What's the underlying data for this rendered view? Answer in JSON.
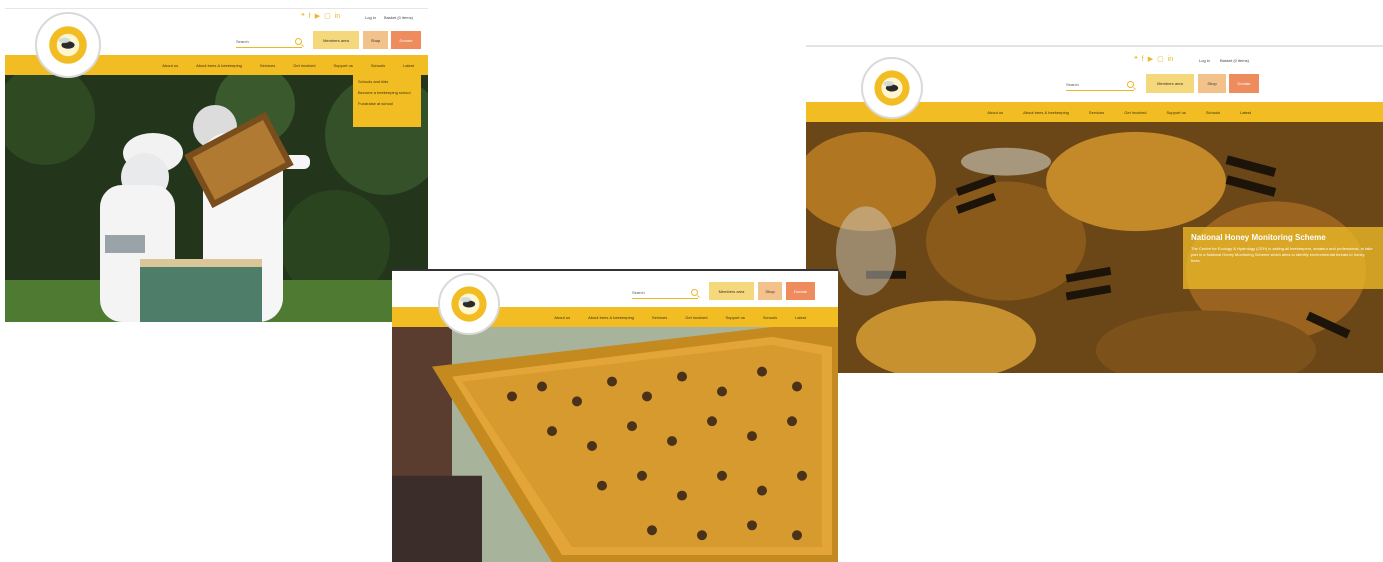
{
  "site": {
    "logo_text": "THE BRITISH BEEKEEPERS ASSOCIATION · FOUNDED 1874"
  },
  "header": {
    "social_icons": [
      "twitter-icon",
      "facebook-icon",
      "youtube-icon",
      "instagram-icon",
      "linkedin-icon"
    ],
    "social_glyphs": [
      "❝",
      "f",
      "▶",
      "▢",
      "in"
    ],
    "login_label": "Log in",
    "basket_label": "Basket (0 items)",
    "search_placeholder": "Search",
    "members_label": "Members area",
    "shop_label": "Shop",
    "donate_label": "Donate"
  },
  "nav": {
    "items": [
      "About us",
      "About bees & beekeeping",
      "Services",
      "Get involved",
      "Support us",
      "Schools",
      "Latest"
    ]
  },
  "schools_dropdown": {
    "items": [
      "Schools and kids",
      "Become a beekeeping school",
      "Fundraise at school"
    ]
  },
  "hero": {
    "title": "National Honey Monitoring Scheme",
    "body": "The Centre for Ecology & Hydrology (CEH) is asking all beekeepers, amateur and professional, to take part in a National Honey Monitoring Scheme which aims to identify environmental threats to honey bees."
  },
  "colors": {
    "brand_yellow": "#f1bd23",
    "members_button": "#f5d77c",
    "shop_button": "#f3c28b",
    "donate_button": "#ee8c5e"
  }
}
